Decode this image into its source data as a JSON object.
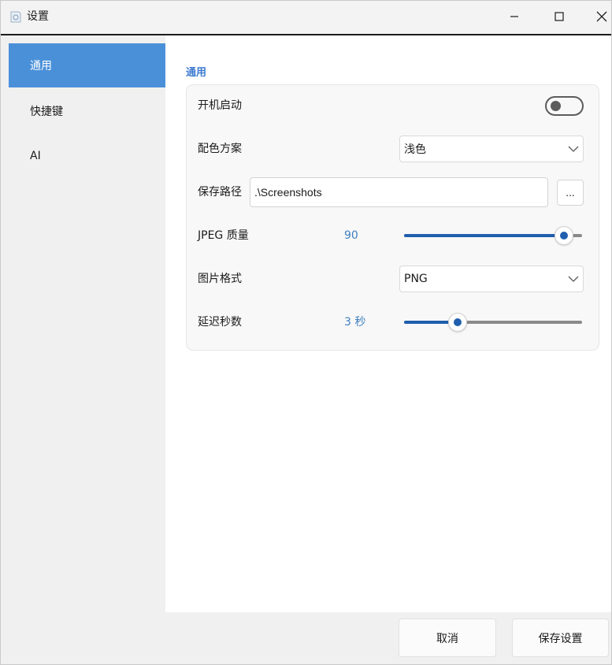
{
  "window": {
    "title": "设置",
    "icon": "app-icon",
    "controls": [
      "minimize-icon",
      "maximize-icon",
      "close-icon"
    ]
  },
  "sidebar": {
    "items": [
      {
        "label": "通用",
        "active": true
      },
      {
        "label": "快捷键",
        "active": false
      },
      {
        "label": "AI",
        "active": false
      }
    ]
  },
  "general": {
    "heading": "通用",
    "startup": {
      "label": "开机启动",
      "enabled": false
    },
    "color_scheme": {
      "label": "配色方案",
      "value": "浅色"
    },
    "save_path": {
      "label": "保存路径",
      "value": ".\\Screenshots",
      "browse_label": "..."
    },
    "jpeg_quality": {
      "label": "JPEG 质量",
      "value_text": "90",
      "value": 90,
      "min": 0,
      "max": 100
    },
    "image_format": {
      "label": "图片格式",
      "value": "PNG"
    },
    "delay": {
      "label": "延迟秒数",
      "value_text": "3 秒",
      "value": 3,
      "min": 0,
      "max": 10
    }
  },
  "footer": {
    "cancel_label": "取消",
    "save_label": "保存设置"
  },
  "colors": {
    "accent": "#4a90d9",
    "slider_fill": "#1f5fad",
    "value_text": "#3f7fbf",
    "heading": "#3d7bd0"
  }
}
